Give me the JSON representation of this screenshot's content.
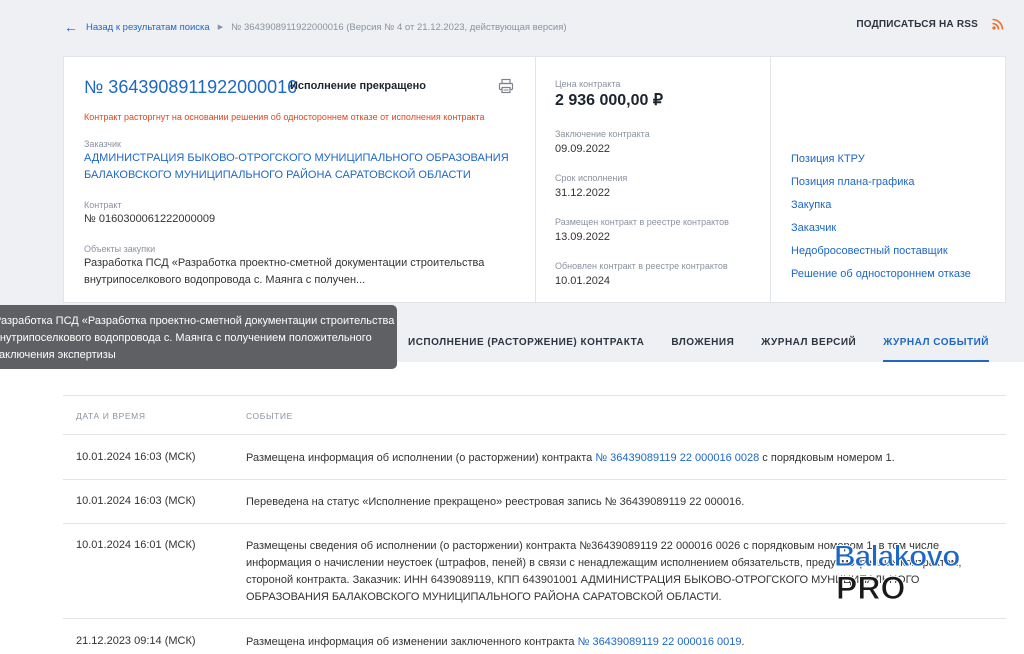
{
  "breadcrumb": {
    "back_label": "Назад к результатам поиска",
    "current": "№ 3643908911922000016 (Версия № 4 от 21.12.2023, действующая версия)"
  },
  "rss_label": "ПОДПИСАТЬСЯ НА RSS",
  "contract": {
    "number": "№ 3643908911922000016",
    "status": "Исполнение прекращено",
    "termination_note": "Контракт расторгнут на основании решения об одностороннем отказе от исполнения контракта",
    "customer_label": "Заказчик",
    "customer_line1": "АДМИНИСТРАЦИЯ БЫКОВО-ОТРОГСКОГО МУНИЦИПАЛЬНОГО ОБРАЗОВАНИЯ",
    "customer_line2": "БАЛАКОВСКОГО МУНИЦИПАЛЬНОГО РАЙОНА САРАТОВСКОЙ ОБЛАСТИ",
    "contract_label": "Контракт",
    "contract_value": "№ 0160300061222000009",
    "objects_label": "Объекты закупки",
    "objects_line1": "Разработка ПСД «Разработка проектно-сметной документации строительства",
    "objects_line2": "внутрипоселкового водопровода с. Маянга с получен..."
  },
  "details": {
    "price_label": "Цена контракта",
    "price_value": "2 936 000,00 ₽",
    "conclusion_label": "Заключение контракта",
    "conclusion_value": "09.09.2022",
    "term_label": "Срок исполнения",
    "term_value": "31.12.2022",
    "placed_label": "Размещен контракт в реестре контрактов",
    "placed_value": "13.09.2022",
    "updated_label": "Обновлен контракт в реестре контрактов",
    "updated_value": "10.01.2024"
  },
  "side_links": [
    "Позиция КТРУ",
    "Позиция плана-графика",
    "Закупка",
    "Заказчик",
    "Недобросовестный поставщик",
    "Решение об одностороннем отказе"
  ],
  "tooltip": {
    "line1": "Разработка ПСД «Разработка проектно-сметной документации строительства",
    "line2": "внутрипоселкового водопровода с. Маянга с получением положительного",
    "line3": "заключения экспертизы"
  },
  "tabs": [
    {
      "label": "ИСПОЛНЕНИЕ (РАСТОРЖЕНИЕ) КОНТРАКТА",
      "active": false
    },
    {
      "label": "ВЛОЖЕНИЯ",
      "active": false
    },
    {
      "label": "ЖУРНАЛ ВЕРСИЙ",
      "active": false
    },
    {
      "label": "ЖУРНАЛ СОБЫТИЙ",
      "active": true
    }
  ],
  "table": {
    "col_date": "ДАТА И ВРЕМЯ",
    "col_event": "СОБЫТИЕ",
    "rows": [
      {
        "date": "10.01.2024 16:03 (МСК)",
        "text_before": "Размещена информация об исполнении (о расторжении) контракта ",
        "link": "№ 36439089119 22 000016 0028",
        "text_after": " с порядковым номером 1."
      },
      {
        "date": "10.01.2024 16:03 (МСК)",
        "text_before": "Переведена на статус «Исполнение прекращено» реестровая запись № 36439089119 22 000016.",
        "link": "",
        "text_after": ""
      },
      {
        "date": "10.01.2024 16:01 (МСК)",
        "text_before": "Размещены сведения об исполнении (о расторжении) контракта №36439089119 22 000016 0026 с порядковым номером 1, в том числе информация о начислении неустоек (штрафов, пеней) в связи с ненадлежащим исполнением обязательств, предусмотренных контрактом, стороной контракта. Заказчик: ИНН 6439089119, КПП 643901001 АДМИНИСТРАЦИЯ БЫКОВО-ОТРОГСКОГО МУНИЦИПАЛЬНОГО ОБРАЗОВАНИЯ БАЛАКОВСКОГО МУНИЦИПАЛЬНОГО РАЙОНА САРАТОВСКОЙ ОБЛАСТИ.",
        "link": "",
        "text_after": ""
      },
      {
        "date": "21.12.2023 09:14 (МСК)",
        "text_before": "Размещена информация об изменении заключенного контракта ",
        "link": "№ 36439089119 22 000016 0019",
        "text_after": "."
      }
    ]
  },
  "watermark": {
    "line1": "Balakovo",
    "line2": "PRO",
    "color": "#1d67c7"
  }
}
